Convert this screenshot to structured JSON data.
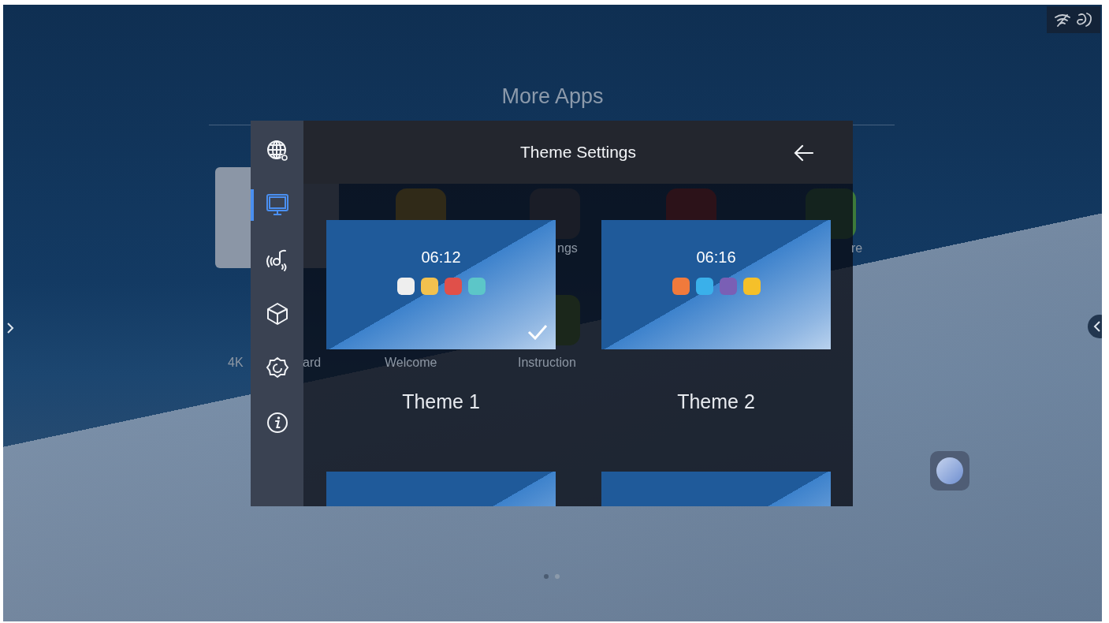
{
  "page_title": "More Apps",
  "background_apps": [
    {
      "label": "ngs"
    },
    {
      "label": "re"
    },
    {
      "label": "4K"
    },
    {
      "label": "ard"
    },
    {
      "label": "Welcome"
    },
    {
      "label": "Instruction"
    }
  ],
  "settings_sidebar": {
    "items": [
      {
        "kind": "globe",
        "selected": false
      },
      {
        "kind": "monitor",
        "selected": true
      },
      {
        "kind": "sound",
        "selected": false
      },
      {
        "kind": "cube",
        "selected": false
      },
      {
        "kind": "gear",
        "selected": false
      },
      {
        "kind": "info",
        "selected": false
      }
    ]
  },
  "dialog": {
    "title": "Theme Settings",
    "themes": [
      {
        "label": "Theme 1",
        "time": "06:12",
        "selected": true
      },
      {
        "label": "Theme 2",
        "time": "06:16",
        "selected": false
      }
    ]
  },
  "page_dots": [
    {
      "selected": true
    },
    {
      "selected": false
    }
  ]
}
